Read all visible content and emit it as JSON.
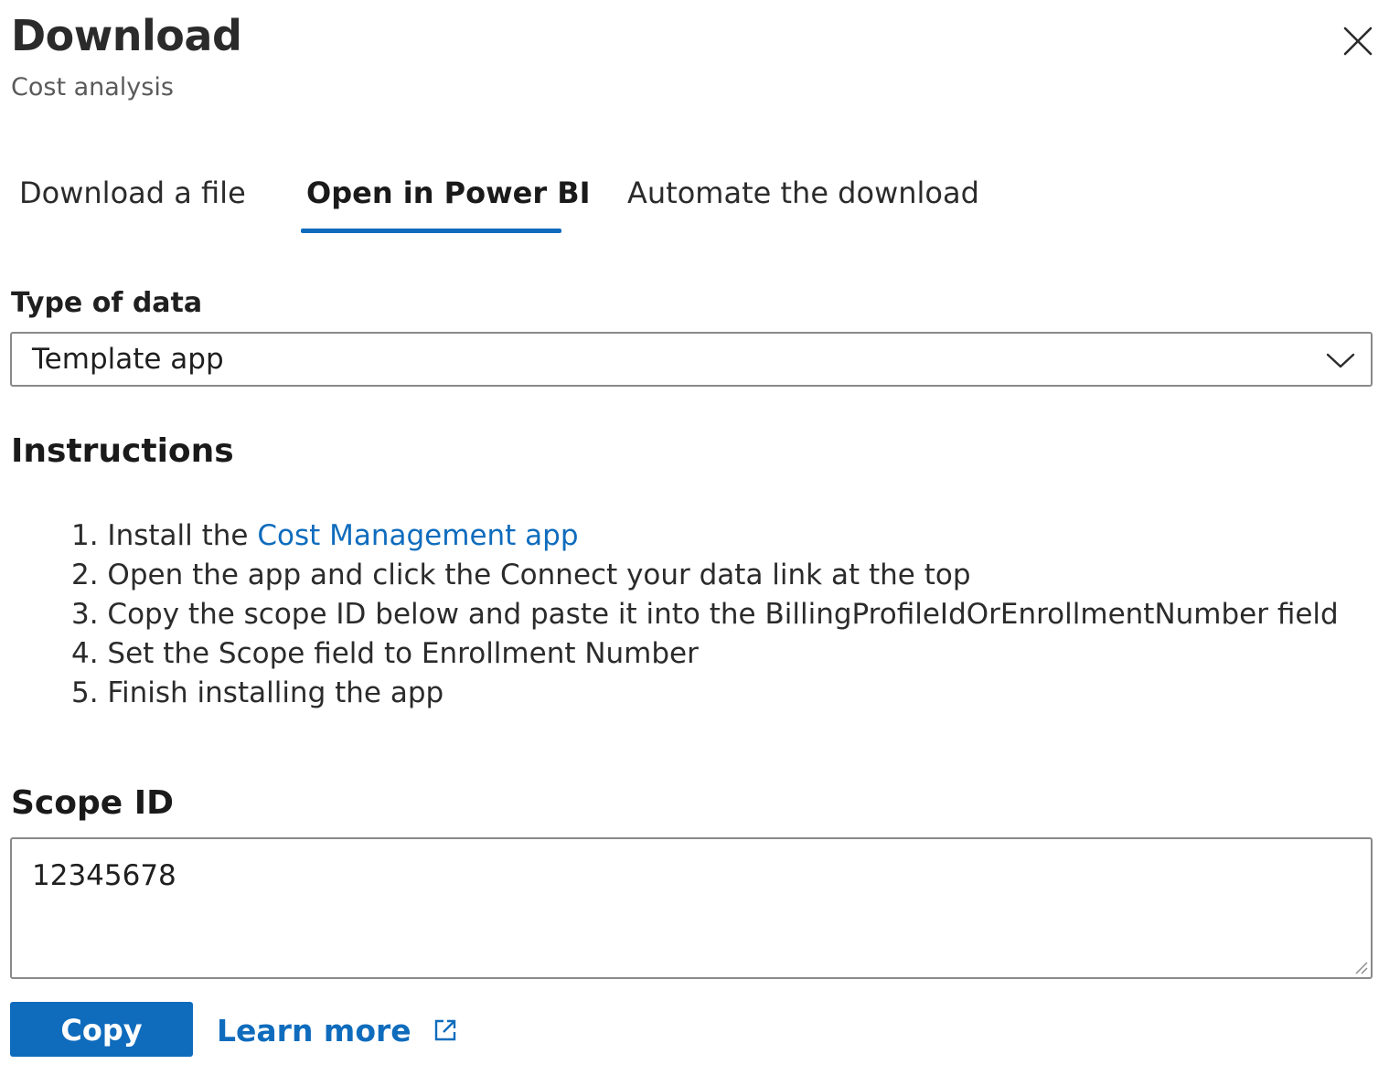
{
  "header": {
    "title": "Download",
    "subtitle": "Cost analysis",
    "close_icon": "close-icon"
  },
  "tabs": [
    {
      "label": "Download a file",
      "selected": false
    },
    {
      "label": "Open in Power BI",
      "selected": true
    },
    {
      "label": "Automate the download",
      "selected": false
    }
  ],
  "type_of_data": {
    "label": "Type of data",
    "value": "Template app",
    "icon": "chevron-down-icon"
  },
  "instructions": {
    "heading": "Instructions",
    "steps": [
      {
        "prefix": "1. Install the ",
        "link": "Cost Management app"
      },
      {
        "text": "2. Open the app and click the Connect your data link at the top"
      },
      {
        "text": "3. Copy the scope ID below and paste it into the BillingProfileIdOrEnrollmentNumber field"
      },
      {
        "text": "4. Set the Scope field to Enrollment Number"
      },
      {
        "text": "5. Finish installing the app"
      }
    ]
  },
  "scope": {
    "heading": "Scope ID",
    "value": "12345678"
  },
  "actions": {
    "copy_label": "Copy",
    "learn_more_label": "Learn more",
    "learn_more_icon": "external-link-icon"
  },
  "colors": {
    "accent": "#0f6cbd",
    "border": "#8a8a8a",
    "text": "#1a1a1a"
  }
}
